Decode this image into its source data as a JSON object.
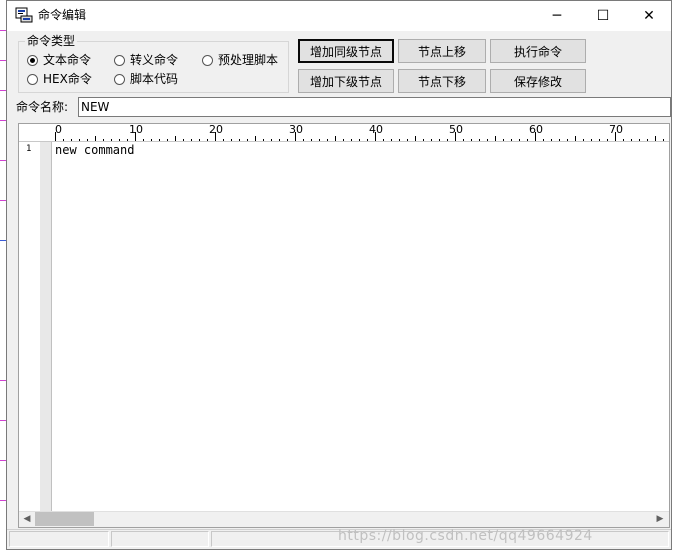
{
  "window": {
    "title": "命令编辑",
    "minimize_glyph": "─",
    "maximize_glyph": "☐",
    "close_glyph": "✕"
  },
  "command_type": {
    "legend": "命令类型",
    "options": [
      {
        "label": "文本命令",
        "selected": true
      },
      {
        "label": "转义命令",
        "selected": false
      },
      {
        "label": "预处理脚本",
        "selected": false
      },
      {
        "label": "HEX命令",
        "selected": false
      },
      {
        "label": "脚本代码",
        "selected": false
      }
    ]
  },
  "buttons": {
    "add_sibling": "增加同级节点",
    "move_up": "节点上移",
    "execute": "执行命令",
    "add_child": "增加下级节点",
    "move_down": "节点下移",
    "save": "保存修改"
  },
  "name_field": {
    "label": "命令名称:",
    "value": "NEW"
  },
  "editor": {
    "ruler_labels": [
      "0",
      "10",
      "20",
      "30",
      "40",
      "50",
      "60",
      "70"
    ],
    "lines": [
      {
        "number": "1",
        "text": "new command"
      }
    ]
  },
  "status": {
    "watermark": "https://blog.csdn.net/qq49664924"
  },
  "colors": {
    "window_bg": "#f0f0f0",
    "button_bg": "#e1e1e1",
    "accent_line": "#d040d0"
  }
}
